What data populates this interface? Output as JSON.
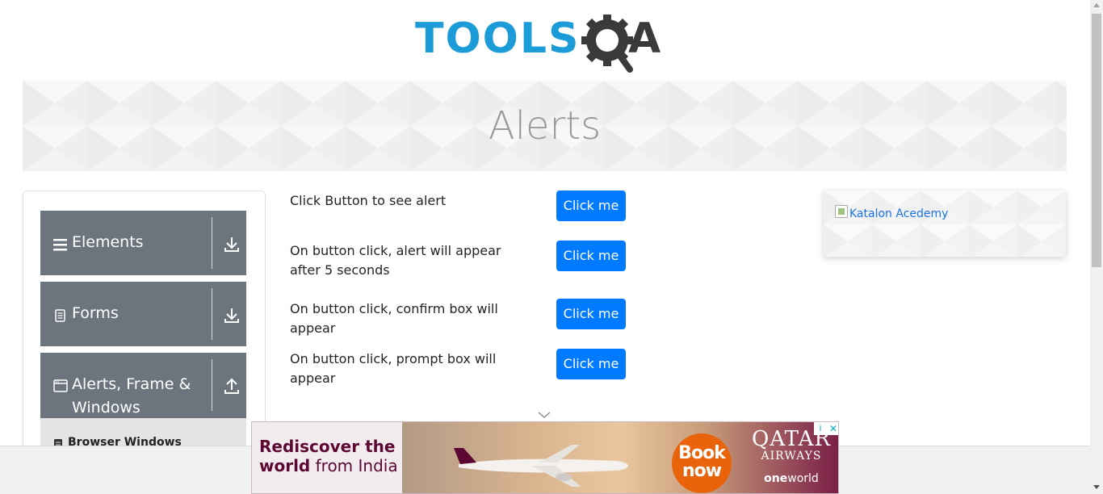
{
  "header": {
    "logo": {
      "tools": "TOOLS",
      "qa": "A"
    }
  },
  "banner": {
    "title": "Alerts"
  },
  "sidebar": {
    "groups": [
      {
        "label": "Elements",
        "icon": "hamburger-icon",
        "state": "collapsed",
        "arrow": "download-arrow-icon"
      },
      {
        "label": "Forms",
        "icon": "document-icon",
        "state": "collapsed",
        "arrow": "download-arrow-icon"
      },
      {
        "label": "Alerts, Frame & Windows",
        "label_line1": "Alerts, Frame &",
        "label_line2": "Windows",
        "icon": "window-icon",
        "state": "expanded",
        "arrow": "upload-arrow-icon"
      }
    ],
    "subitems": [
      {
        "label": "Browser Windows",
        "icon": "document-icon"
      }
    ]
  },
  "main": {
    "rows": [
      {
        "text": "Click Button to see alert",
        "button": "Click me"
      },
      {
        "text": "On button click, alert will appear after 5 seconds",
        "button": "Click me"
      },
      {
        "text": "On button click, confirm box will appear",
        "button": "Click me"
      },
      {
        "text": "On button click, prompt box will appear",
        "button": "Click me"
      }
    ]
  },
  "side_ad": {
    "alt": "Katalon Acedemy"
  },
  "bottom_ad": {
    "headline_bold1": "Rediscover the",
    "headline_bold2": "world",
    "headline_light": " from India",
    "cta_line1": "Book",
    "cta_line2": "now",
    "brand": "QATAR",
    "brand_sub": "AIRWAYS",
    "alliance_bold": "one",
    "alliance_light": "world",
    "info": "i",
    "close": "✕"
  },
  "colors": {
    "primary_button": "#007bff",
    "sidebar_group": "#6c757d",
    "logo_blue": "#1b9bd7",
    "logo_dark": "#3a3a3a",
    "qatar_maroon": "#5c0632",
    "cta_orange": "#e8630a"
  }
}
